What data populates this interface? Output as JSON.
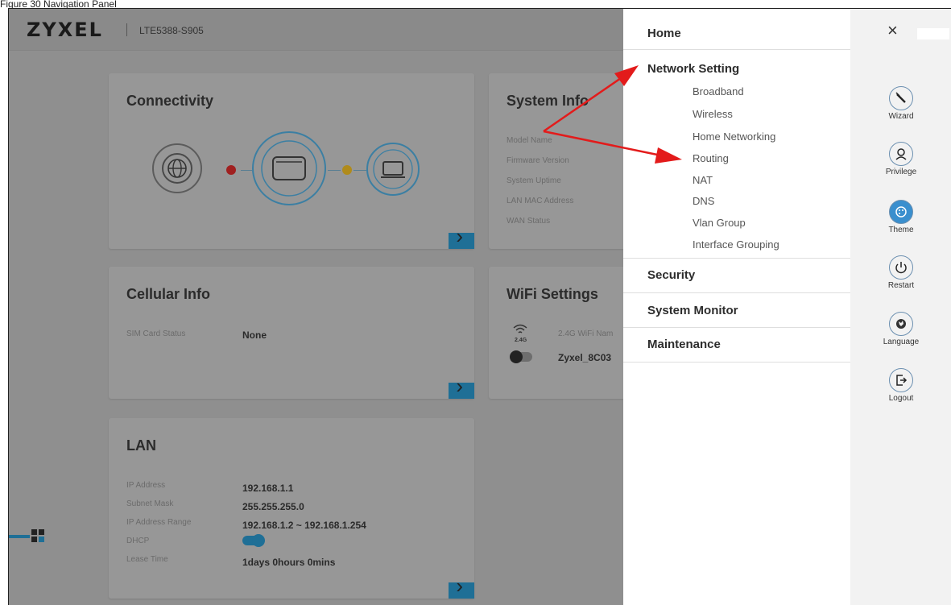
{
  "caption": "Figure 30 Navigation Panel",
  "header": {
    "brand": "ZYXEL",
    "model": "LTE5388-S905"
  },
  "cards": {
    "connectivity": {
      "title": "Connectivity"
    },
    "system_info": {
      "title": "System Info",
      "labels": [
        "Model Name",
        "Firmware Version",
        "System Uptime",
        "LAN MAC Address",
        "WAN Status"
      ]
    },
    "cellular": {
      "title": "Cellular Info",
      "sim_label": "SIM Card Status",
      "sim_value": "None"
    },
    "wifi": {
      "title": "WiFi Settings",
      "band_label": "2.4G WiFi Nam",
      "band_badge": "2.4G",
      "ssid": "Zyxel_8C03"
    },
    "lan": {
      "title": "LAN",
      "rows": [
        {
          "label": "IP Address",
          "value": "192.168.1.1"
        },
        {
          "label": "Subnet Mask",
          "value": "255.255.255.0"
        },
        {
          "label": "IP Address Range",
          "value": "192.168.1.2 ~ 192.168.1.254"
        },
        {
          "label": "DHCP",
          "value": ""
        },
        {
          "label": "Lease Time",
          "value": "1days 0hours 0mins"
        }
      ]
    }
  },
  "menu": {
    "home": "Home",
    "network_setting": "Network Setting",
    "network_items": [
      "Broadband",
      "Wireless",
      "Home Networking",
      "Routing",
      "NAT",
      "DNS",
      "Vlan Group",
      "Interface Grouping"
    ],
    "security": "Security",
    "system_monitor": "System Monitor",
    "maintenance": "Maintenance"
  },
  "sidebar": {
    "close_glyph": "×",
    "items": [
      {
        "label": "Wizard",
        "icon": "wand-icon"
      },
      {
        "label": "Privilege",
        "icon": "user-icon"
      },
      {
        "label": "Theme",
        "icon": "palette-icon"
      },
      {
        "label": "Restart",
        "icon": "power-icon"
      },
      {
        "label": "Language",
        "icon": "globe-icon"
      },
      {
        "label": "Logout",
        "icon": "logout-icon"
      }
    ]
  },
  "colors": {
    "accent": "#1f6f96",
    "annotation": "#e31b1b",
    "menu_bg": "#ffffff",
    "sidebar_bg": "#f2f2f2"
  }
}
